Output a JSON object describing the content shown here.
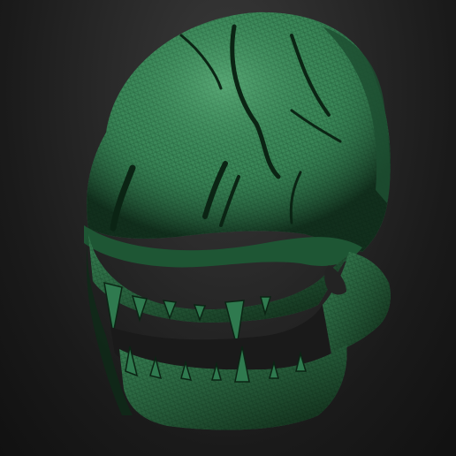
{
  "viewport": {
    "background_top": "#3a3a3a",
    "background_bottom": "#111111"
  },
  "model": {
    "subject": "mask-mesh",
    "base_color": "#2f7a4f",
    "highlight_color": "#5fae7a",
    "shadow_color": "#0d2a18",
    "wire_color": "#1f5a36"
  }
}
